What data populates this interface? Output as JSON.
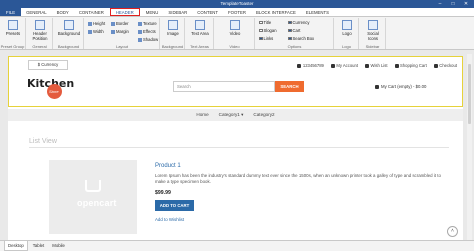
{
  "app": {
    "title": "TemplateToaster"
  },
  "window_controls": [
    "–",
    "□",
    "✕"
  ],
  "tabs": [
    "FILE",
    "GENERAL",
    "BODY",
    "CONTAINER",
    "HEADER",
    "MENU",
    "SIDEBAR",
    "CONTENT",
    "FOOTER",
    "BLOCK INTERFACE",
    "ELEMENTS"
  ],
  "active_tab": "HEADER",
  "ribbon": {
    "presets": {
      "label": "Presets",
      "group": "Preset Group"
    },
    "header_position": {
      "label": "Header Position",
      "group": "General"
    },
    "background": {
      "label": "Background",
      "group": "Background"
    },
    "height": "Height",
    "border": "Border",
    "width": "Width",
    "margin": "Margin",
    "texture": "Texture",
    "effects": "Effects",
    "shadow": "Shadow",
    "layout_group": "Layout",
    "image": {
      "label": "Image",
      "group": "Background"
    },
    "text_area": {
      "label": "Text Area",
      "group": "Text Areas"
    },
    "video": {
      "label": "Video",
      "group": "Video"
    },
    "options": [
      {
        "label": "Title",
        "checked": false
      },
      {
        "label": "Slogan",
        "checked": false
      },
      {
        "label": "Links",
        "checked": true
      },
      {
        "label": "Currency",
        "checked": true
      },
      {
        "label": "Cart",
        "checked": true
      },
      {
        "label": "Search Box",
        "checked": true
      }
    ],
    "options_group": "Options",
    "logo": {
      "label": "Logo",
      "group": "Logo"
    },
    "social": {
      "label": "Social Icons",
      "group": "Sidebar"
    }
  },
  "store": {
    "currency_btn": "$ Currency",
    "phone": "123456789",
    "my_account": "My Account",
    "wish_list": "Wish List",
    "shopping_cart": "Shopping Cart",
    "checkout": "Checkout",
    "logo_text": "Kitchen",
    "logo_script": "Store",
    "search_placeholder": "Search",
    "search_btn": "SEARCH",
    "cart_summary": "My Cart (empty) - $0.00",
    "menu": [
      "Home",
      "Category1 ▾",
      "Category2"
    ],
    "list_view": "List View",
    "product": {
      "name": "Product 1",
      "description": "Lorem Ipsum has been the industry's standard dummy text ever since the 1500s, when an unknown printer took a galley of type and scrambled it to make a type specimen book.",
      "price": "$99.99",
      "add_to_cart": "ADD TO CART",
      "wishlist": "Add to Wishlist",
      "image_text": "opencart"
    }
  },
  "devices": [
    "Desktop",
    "Tablet",
    "Mobile"
  ],
  "active_device": "Desktop",
  "colors": {
    "brand": "#2b5797",
    "accent": "#ef6b2f",
    "highlight": "#e02020",
    "header_outline": "#e6d23a"
  }
}
